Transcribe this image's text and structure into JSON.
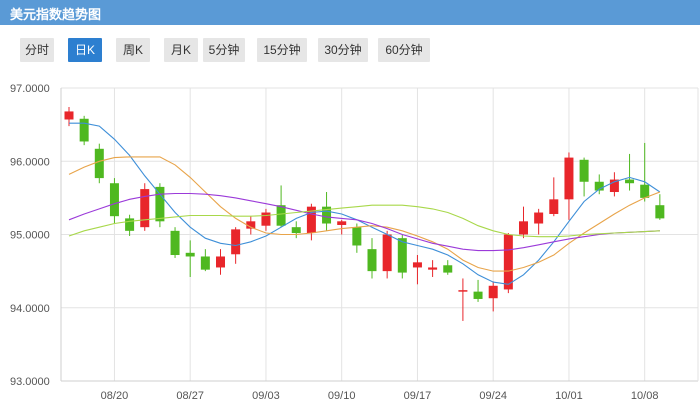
{
  "header": {
    "title": "美元指数趋势图"
  },
  "tabs": [
    {
      "label": "分时",
      "active": false
    },
    {
      "label": "日K",
      "active": true
    },
    {
      "label": "周K",
      "active": false
    },
    {
      "label": "月K",
      "active": false
    },
    {
      "label": "5分钟",
      "active": false
    },
    {
      "label": "15分钟",
      "active": false
    },
    {
      "label": "30分钟",
      "active": false
    },
    {
      "label": "60分钟",
      "active": false
    }
  ],
  "colors": {
    "header_bg": "#5a9ad6",
    "tab_active": "#2d7fd0",
    "up": "#e8262b",
    "down": "#4fb820",
    "ma_blue": "#3e8fd8",
    "ma_orange": "#e8a44a",
    "ma_purple": "#9b3ad9",
    "ma_green": "#a8d84a",
    "grid": "#e3e3e3"
  },
  "chart_data": {
    "type": "candlestick",
    "ylim": [
      93.0,
      97.0
    ],
    "y_ticks": [
      "97.0000",
      "96.0000",
      "95.0000",
      "94.0000",
      "93.0000"
    ],
    "x_ticks": [
      {
        "label": "08/20",
        "index": 3
      },
      {
        "label": "08/27",
        "index": 8
      },
      {
        "label": "09/03",
        "index": 13
      },
      {
        "label": "09/10",
        "index": 18
      },
      {
        "label": "09/17",
        "index": 23
      },
      {
        "label": "09/24",
        "index": 28
      },
      {
        "label": "10/01",
        "index": 33
      },
      {
        "label": "10/08",
        "index": 38
      }
    ],
    "candles": [
      {
        "o": 96.57,
        "h": 96.74,
        "l": 96.48,
        "c": 96.68
      },
      {
        "o": 96.58,
        "h": 96.62,
        "l": 96.22,
        "c": 96.27
      },
      {
        "o": 96.17,
        "h": 96.24,
        "l": 95.7,
        "c": 95.77
      },
      {
        "o": 95.7,
        "h": 95.77,
        "l": 95.15,
        "c": 95.25
      },
      {
        "o": 95.22,
        "h": 95.27,
        "l": 94.98,
        "c": 95.05
      },
      {
        "o": 95.1,
        "h": 95.7,
        "l": 95.05,
        "c": 95.62
      },
      {
        "o": 95.65,
        "h": 95.7,
        "l": 95.1,
        "c": 95.18
      },
      {
        "o": 95.05,
        "h": 95.1,
        "l": 94.68,
        "c": 94.72
      },
      {
        "o": 94.75,
        "h": 94.92,
        "l": 94.42,
        "c": 94.7
      },
      {
        "o": 94.7,
        "h": 94.8,
        "l": 94.5,
        "c": 94.52
      },
      {
        "o": 94.55,
        "h": 94.8,
        "l": 94.45,
        "c": 94.7
      },
      {
        "o": 94.73,
        "h": 95.1,
        "l": 94.6,
        "c": 95.07
      },
      {
        "o": 95.08,
        "h": 95.25,
        "l": 95.0,
        "c": 95.18
      },
      {
        "o": 95.12,
        "h": 95.35,
        "l": 95.05,
        "c": 95.3
      },
      {
        "o": 95.4,
        "h": 95.67,
        "l": 95.1,
        "c": 95.12
      },
      {
        "o": 95.1,
        "h": 95.18,
        "l": 94.95,
        "c": 95.02
      },
      {
        "o": 95.02,
        "h": 95.42,
        "l": 94.92,
        "c": 95.38
      },
      {
        "o": 95.38,
        "h": 95.58,
        "l": 95.05,
        "c": 95.15
      },
      {
        "o": 95.13,
        "h": 95.2,
        "l": 95.0,
        "c": 95.18
      },
      {
        "o": 95.1,
        "h": 95.15,
        "l": 94.75,
        "c": 94.85
      },
      {
        "o": 94.8,
        "h": 94.95,
        "l": 94.4,
        "c": 94.5
      },
      {
        "o": 94.5,
        "h": 95.05,
        "l": 94.4,
        "c": 95.0
      },
      {
        "o": 94.95,
        "h": 95.0,
        "l": 94.4,
        "c": 94.48
      },
      {
        "o": 94.55,
        "h": 94.72,
        "l": 94.32,
        "c": 94.62
      },
      {
        "o": 94.52,
        "h": 94.65,
        "l": 94.42,
        "c": 94.55
      },
      {
        "o": 94.58,
        "h": 94.65,
        "l": 94.45,
        "c": 94.48
      },
      {
        "o": 94.23,
        "h": 94.4,
        "l": 93.82,
        "c": 94.24
      },
      {
        "o": 94.22,
        "h": 94.38,
        "l": 94.08,
        "c": 94.12
      },
      {
        "o": 94.13,
        "h": 94.36,
        "l": 93.95,
        "c": 94.3
      },
      {
        "o": 94.25,
        "h": 95.02,
        "l": 94.2,
        "c": 95.0
      },
      {
        "o": 95.0,
        "h": 95.38,
        "l": 94.95,
        "c": 95.18
      },
      {
        "o": 95.15,
        "h": 95.35,
        "l": 95.0,
        "c": 95.3
      },
      {
        "o": 95.28,
        "h": 95.78,
        "l": 95.25,
        "c": 95.48
      },
      {
        "o": 95.48,
        "h": 96.12,
        "l": 95.2,
        "c": 96.05
      },
      {
        "o": 96.02,
        "h": 96.05,
        "l": 95.52,
        "c": 95.72
      },
      {
        "o": 95.72,
        "h": 95.82,
        "l": 95.55,
        "c": 95.6
      },
      {
        "o": 95.58,
        "h": 95.85,
        "l": 95.52,
        "c": 95.75
      },
      {
        "o": 95.75,
        "h": 96.1,
        "l": 95.6,
        "c": 95.7
      },
      {
        "o": 95.68,
        "h": 96.25,
        "l": 95.45,
        "c": 95.5
      },
      {
        "o": 95.4,
        "h": 95.55,
        "l": 95.2,
        "c": 95.22
      }
    ],
    "ma_lines": [
      {
        "color": "#3e8fd8",
        "values": [
          96.52,
          96.52,
          96.48,
          96.3,
          96.08,
          95.8,
          95.55,
          95.3,
          95.1,
          94.95,
          94.88,
          94.85,
          94.9,
          94.98,
          95.1,
          95.22,
          95.3,
          95.32,
          95.28,
          95.2,
          95.1,
          95.0,
          94.9,
          94.85,
          94.8,
          94.72,
          94.6,
          94.45,
          94.35,
          94.32,
          94.45,
          94.65,
          94.9,
          95.18,
          95.45,
          95.62,
          95.72,
          95.78,
          95.72,
          95.58
        ]
      },
      {
        "color": "#e8a44a",
        "values": [
          95.82,
          95.92,
          96.0,
          96.05,
          96.06,
          96.06,
          96.06,
          95.95,
          95.78,
          95.58,
          95.38,
          95.22,
          95.1,
          95.02,
          95.0,
          95.0,
          95.02,
          95.05,
          95.08,
          95.1,
          95.12,
          95.1,
          95.05,
          94.98,
          94.9,
          94.8,
          94.65,
          94.55,
          94.5,
          94.5,
          94.55,
          94.62,
          94.72,
          94.88,
          95.02,
          95.15,
          95.28,
          95.4,
          95.5,
          95.58
        ]
      },
      {
        "color": "#9b3ad9",
        "values": [
          95.2,
          95.28,
          95.35,
          95.42,
          95.48,
          95.52,
          95.55,
          95.56,
          95.56,
          95.55,
          95.53,
          95.5,
          95.46,
          95.42,
          95.38,
          95.33,
          95.28,
          95.24,
          95.22,
          95.2,
          95.15,
          95.08,
          95.0,
          94.94,
          94.88,
          94.84,
          94.8,
          94.78,
          94.78,
          94.79,
          94.82,
          94.86,
          94.9,
          94.94,
          94.97,
          95.0,
          95.02,
          95.03,
          95.04,
          95.05
        ]
      },
      {
        "color": "#a8d84a",
        "values": [
          94.98,
          95.05,
          95.1,
          95.15,
          95.18,
          95.2,
          95.22,
          95.24,
          95.26,
          95.26,
          95.26,
          95.25,
          95.25,
          95.26,
          95.28,
          95.3,
          95.32,
          95.34,
          95.36,
          95.38,
          95.4,
          95.4,
          95.4,
          95.38,
          95.35,
          95.3,
          95.22,
          95.12,
          95.05,
          95.0,
          94.98,
          94.97,
          94.97,
          94.98,
          95.0,
          95.01,
          95.02,
          95.03,
          95.04,
          95.05
        ]
      }
    ]
  }
}
